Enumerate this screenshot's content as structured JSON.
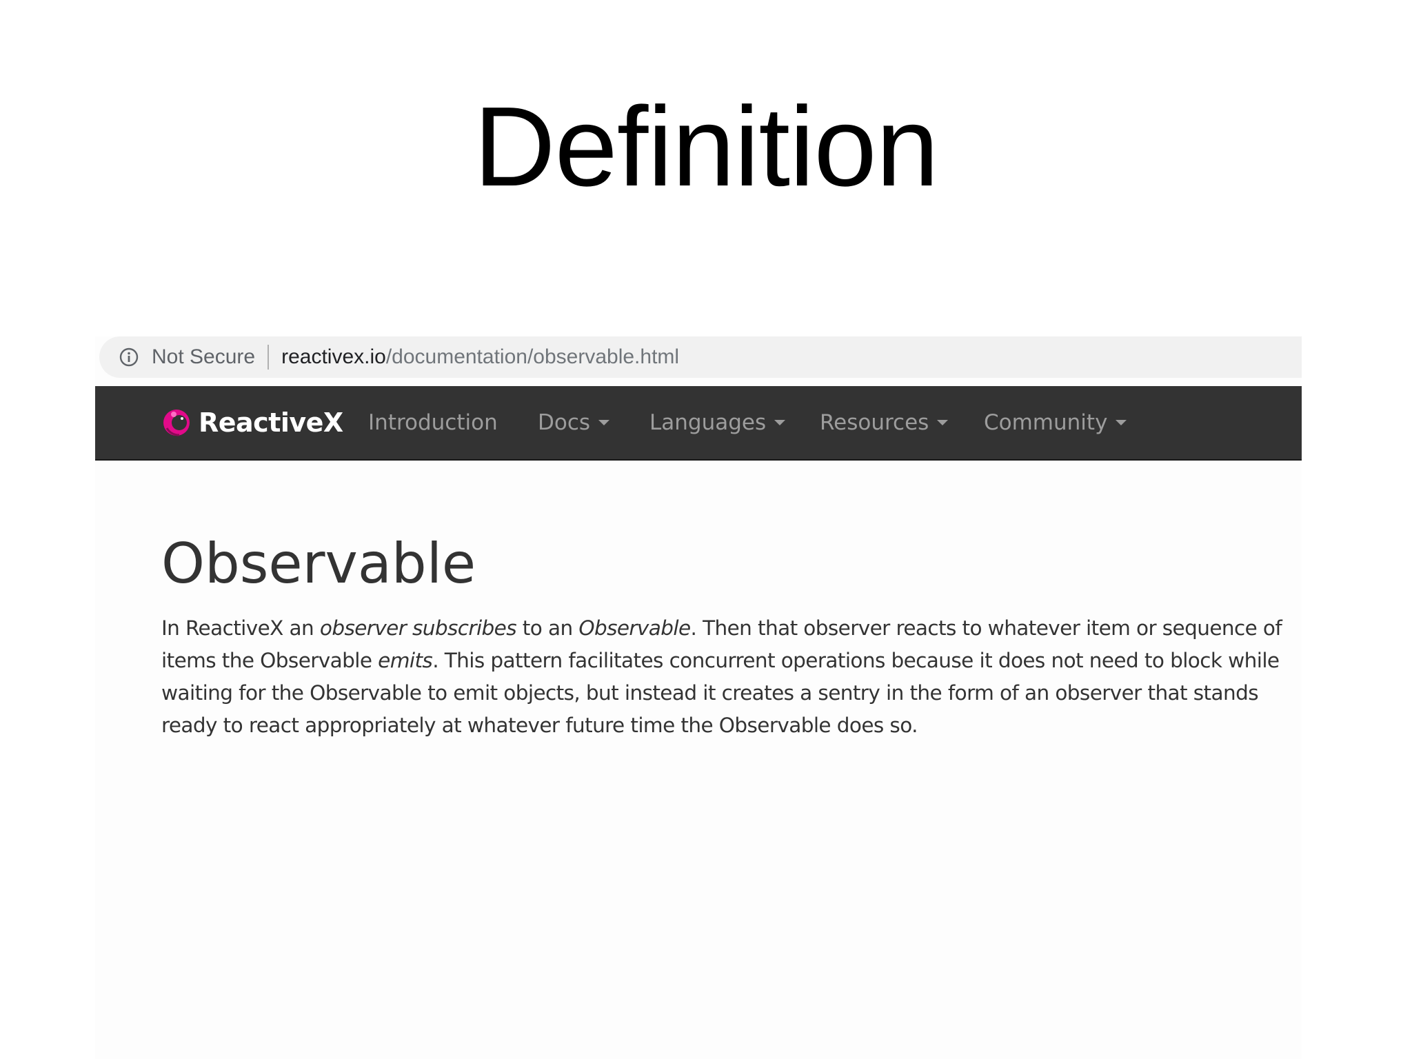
{
  "slide": {
    "title": "Definition"
  },
  "browser": {
    "security_label": "Not Secure",
    "url_domain": "reactivex.io",
    "url_path": "/documentation/observable.html"
  },
  "navbar": {
    "brand": "ReactiveX",
    "items": [
      {
        "label": "Introduction",
        "has_dropdown": false
      },
      {
        "label": "Docs",
        "has_dropdown": true
      },
      {
        "label": "Languages",
        "has_dropdown": true
      },
      {
        "label": "Resources",
        "has_dropdown": true
      },
      {
        "label": "Community",
        "has_dropdown": true
      }
    ]
  },
  "content": {
    "heading": "Observable",
    "paragraph": {
      "p1": "In ReactiveX an ",
      "observer_subscribes": "observer subscribes",
      "p2": " to an ",
      "observable": "Observable",
      "p3": ". Then that observer reacts to whatever item or sequence of items the Observable ",
      "emits": "emits",
      "p4": ". This pattern facilitates concurrent operations because it does not need to block while waiting for the Observable to emit objects, but instead it creates a sentry in the form of an observer that stands ready to react appropriately at whatever future time the Observable does so."
    }
  },
  "colors": {
    "navbar_bg": "#333333",
    "nav_text": "#9d9d9d",
    "brand_text": "#ffffff",
    "logo_accent": "#e20a8a",
    "body_text": "#333333"
  },
  "icons": {
    "info": "info-circle-icon",
    "logo": "reactivex-logo-icon",
    "dropdown": "caret-down-icon"
  }
}
